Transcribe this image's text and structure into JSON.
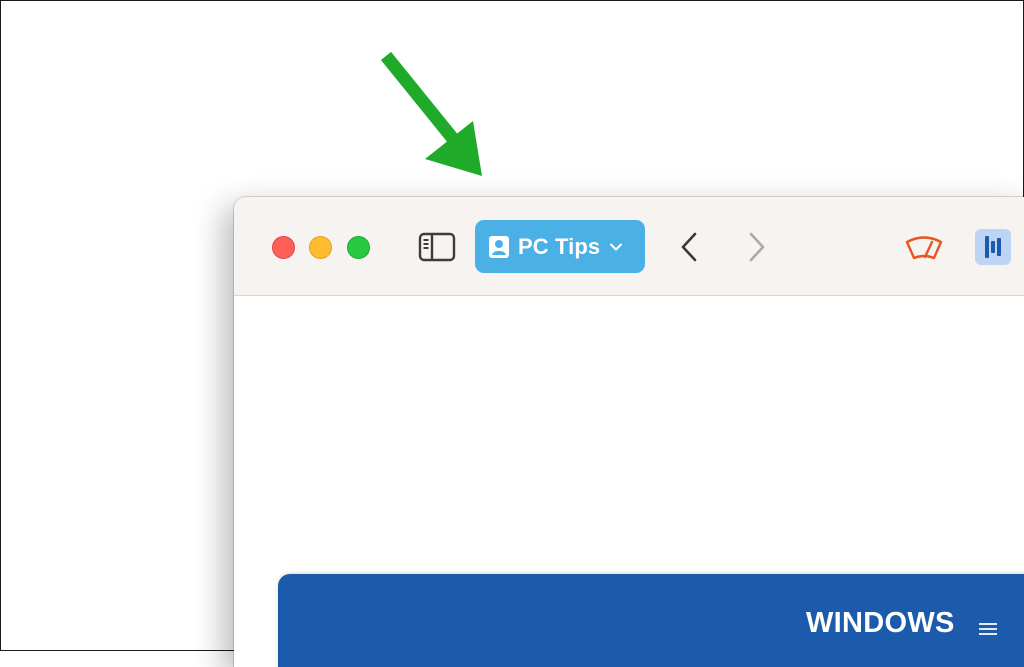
{
  "colors": {
    "arrow": "#1faa2a",
    "traffic_close": "#fe5f57",
    "traffic_minimize": "#febc2e",
    "traffic_zoom": "#28c840",
    "tab_group_bg": "#4ab0e6",
    "toolbar_bg": "#f6f3f1",
    "site_header_bg": "#1c5bab",
    "wiper_extension": "#e8551c",
    "bars_extension_bg": "#bdd4f4",
    "bars_extension_fg": "#1c5bab"
  },
  "icons": {
    "arrow": "arrow-pointer-icon",
    "sidebar": "sidebar-icon",
    "profile": "profile-badge-icon",
    "tab_group_chevron": "chevron-down-icon",
    "back": "chevron-left-icon",
    "forward": "chevron-right-icon",
    "wiper": "windshield-wiper-icon",
    "bars": "bars-extension-icon",
    "menu": "hamburger-menu-icon"
  },
  "toolbar": {
    "tab_group_label": "PC Tips"
  },
  "site": {
    "menu_label": "WINDOWS"
  }
}
